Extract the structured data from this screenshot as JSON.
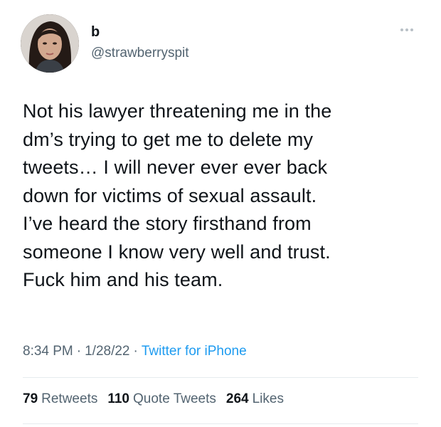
{
  "tweet": {
    "display_name": "b",
    "handle": "@strawberryspit",
    "text": "Not his lawyer threatening me in the\ndm’s trying to get me to delete my\ntweets… I will never ever ever back\ndown for victims of sexual assault.\nI’ve heard the story firsthand from\nsomeone I know very well and trust.\nFuck him and his team.",
    "time": "8:34 PM",
    "date": "1/28/22",
    "source": "Twitter for iPhone",
    "separator": "·"
  },
  "stats": {
    "retweets_count": "79",
    "retweets_label": "Retweets",
    "quotes_count": "110",
    "quotes_label": "Quote Tweets",
    "likes_count": "264",
    "likes_label": "Likes"
  },
  "icons": {
    "avatar": "profile-photo",
    "more": "more-horizontal-icon"
  },
  "colors": {
    "text_primary": "#0f1419",
    "text_secondary": "#536471",
    "link": "#1d9bf0",
    "divider": "#e6ebee"
  }
}
